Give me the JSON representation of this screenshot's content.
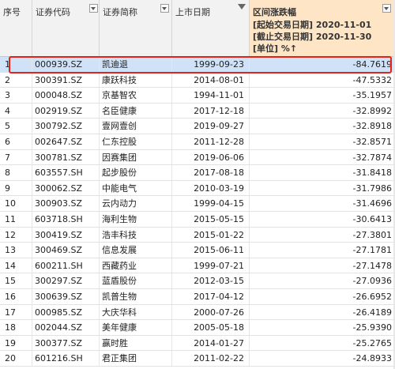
{
  "headers": {
    "seq": "序号",
    "code": "证券代码",
    "name": "证券简称",
    "date": "上市日期",
    "change_title": "区间涨跌幅",
    "change_start": "[起始交易日期] 2020-11-01",
    "change_end": "[截止交易日期] 2020-11-30",
    "change_unit": "[单位] %↑"
  },
  "rows": [
    {
      "seq": "1",
      "code": "000939.SZ",
      "name": "凯迪退",
      "date": "1999-09-23",
      "change": "-84.7619"
    },
    {
      "seq": "2",
      "code": "300391.SZ",
      "name": "康跃科技",
      "date": "2014-08-01",
      "change": "-47.5332"
    },
    {
      "seq": "3",
      "code": "000048.SZ",
      "name": "京基智农",
      "date": "1994-11-01",
      "change": "-35.1957"
    },
    {
      "seq": "4",
      "code": "002919.SZ",
      "name": "名臣健康",
      "date": "2017-12-18",
      "change": "-32.8992"
    },
    {
      "seq": "5",
      "code": "300792.SZ",
      "name": "壹网壹创",
      "date": "2019-09-27",
      "change": "-32.8918"
    },
    {
      "seq": "6",
      "code": "002647.SZ",
      "name": "仁东控股",
      "date": "2011-12-28",
      "change": "-32.8571"
    },
    {
      "seq": "7",
      "code": "300781.SZ",
      "name": "因赛集团",
      "date": "2019-06-06",
      "change": "-32.7874"
    },
    {
      "seq": "8",
      "code": "603557.SH",
      "name": "起步股份",
      "date": "2017-08-18",
      "change": "-31.8418"
    },
    {
      "seq": "9",
      "code": "300062.SZ",
      "name": "中能电气",
      "date": "2010-03-19",
      "change": "-31.7986"
    },
    {
      "seq": "10",
      "code": "300903.SZ",
      "name": "云内动力",
      "date": "1999-04-15",
      "change": "-31.4696"
    },
    {
      "seq": "11",
      "code": "603718.SH",
      "name": "海利生物",
      "date": "2015-05-15",
      "change": "-30.6413"
    },
    {
      "seq": "12",
      "code": "300419.SZ",
      "name": "浩丰科技",
      "date": "2015-01-22",
      "change": "-27.3801"
    },
    {
      "seq": "13",
      "code": "300469.SZ",
      "name": "信息发展",
      "date": "2015-06-11",
      "change": "-27.1781"
    },
    {
      "seq": "14",
      "code": "600211.SH",
      "name": "西藏药业",
      "date": "1999-07-21",
      "change": "-27.1478"
    },
    {
      "seq": "15",
      "code": "300297.SZ",
      "name": "蓝盾股份",
      "date": "2012-03-15",
      "change": "-27.0936"
    },
    {
      "seq": "16",
      "code": "300639.SZ",
      "name": "凯普生物",
      "date": "2017-04-12",
      "change": "-26.6952"
    },
    {
      "seq": "17",
      "code": "000985.SZ",
      "name": "大庆华科",
      "date": "2000-07-26",
      "change": "-26.4189"
    },
    {
      "seq": "18",
      "code": "002044.SZ",
      "name": "美年健康",
      "date": "2005-05-18",
      "change": "-25.9390"
    },
    {
      "seq": "19",
      "code": "300377.SZ",
      "name": "赢时胜",
      "date": "2014-01-27",
      "change": "-25.2765"
    },
    {
      "seq": "20",
      "code": "601216.SH",
      "name": "君正集团",
      "date": "2011-02-22",
      "change": "-24.8933"
    }
  ]
}
